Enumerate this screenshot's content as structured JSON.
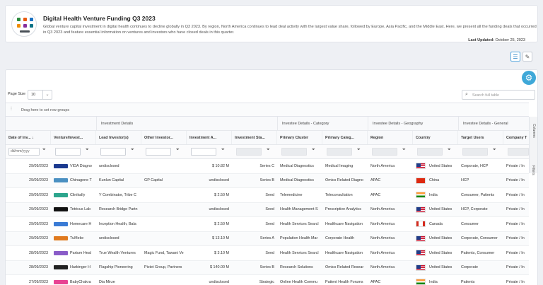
{
  "header": {
    "title": "Digital Health Venture Funding Q3 2023",
    "description": "Global venture capital investment in digital health continues to decline globally in Q3 2023. By region, North America continues to lead deal activity with the largest value share, followed by Europe, Asia Pacific, and the Middle East. Here, we present all the funding deals that occurred in Q3 2023 and feature essential information on ventures and investors who have closed deals in this quarter.",
    "updated_label": "Last Updated:",
    "updated_value": "October 25, 2023"
  },
  "toolbar": {
    "page_size_label": "Page Size",
    "page_size_value": "10",
    "search_placeholder": "Search full table",
    "group_hint": "Drag here to set row groups"
  },
  "side_tabs": {
    "columns": "Columns",
    "filters": "Filters"
  },
  "column_groups": [
    "Investment Details",
    "Investee Details - Category",
    "Investee Details - Geography",
    "Investee Details - General"
  ],
  "columns": [
    "Date of Inv...",
    "Venture/Invest...",
    "Lead Investor(s)",
    "Other Investor...",
    "Investment A...",
    "Investment Sta...",
    "Primary Cluster",
    "Primary Categ...",
    "Region",
    "Country",
    "Target Users",
    "Company T"
  ],
  "date_filter_placeholder": "dd/mm/yyyy",
  "rows": [
    {
      "date": "29/09/2023",
      "venture": "VIDA Diagno",
      "lead": "undisclosed",
      "other": "",
      "amount": "$ 10.82 M",
      "stage": "Series C",
      "cluster": "Medical Diagnostics",
      "category": "Medical Imaging",
      "region": "North America",
      "country": "United States",
      "flag": "us",
      "users": "Corporate, HCP",
      "company": "Private / In"
    },
    {
      "date": "29/09/2023",
      "venture": "Chinagene T",
      "lead": "Kunlun Capital",
      "other": "GP Capital",
      "amount": "undisclosed",
      "stage": "Series B",
      "cluster": "Medical Diagnostics",
      "category": "Omics Related Diagno",
      "region": "APAC",
      "country": "China",
      "flag": "cn",
      "users": "HCP",
      "company": "Private / In"
    },
    {
      "date": "29/09/2023",
      "venture": "Clinikally",
      "lead": "Y Combinator, Tribe C",
      "other": "",
      "amount": "$ 2.50 M",
      "stage": "Seed",
      "cluster": "Telemedicine",
      "category": "Teleconsultation",
      "region": "APAC",
      "country": "India",
      "flag": "in",
      "users": "Consumer, Patients",
      "company": "Private / In"
    },
    {
      "date": "29/09/2023",
      "venture": "Tetricus Lab",
      "lead": "Research Bridge Partn",
      "other": "",
      "amount": "undisclosed",
      "stage": "Seed",
      "cluster": "Health Management S",
      "category": "Prescriptive Analytics",
      "region": "North America",
      "country": "United States",
      "flag": "us",
      "users": "HCP, Corporate",
      "company": "Private / In"
    },
    {
      "date": "29/09/2023",
      "venture": "Homecare H",
      "lead": "Inception Health, Bala",
      "other": "",
      "amount": "$ 2.50 M",
      "stage": "Seed",
      "cluster": "Health Services Searcl",
      "category": "Healthcare Navigation",
      "region": "North America",
      "country": "Canada",
      "flag": "ca",
      "users": "Consumer",
      "company": "Private / In"
    },
    {
      "date": "29/09/2023",
      "venture": "TuMeke",
      "lead": "undisclosed",
      "other": "",
      "amount": "$ 13.10 M",
      "stage": "Series A",
      "cluster": "Population Health Mar",
      "category": "Corporate Health",
      "region": "North America",
      "country": "United States",
      "flag": "us",
      "users": "Corporate, Consumer",
      "company": "Private / In"
    },
    {
      "date": "28/09/2023",
      "venture": "Partum Heal",
      "lead": "True Wealth Ventures",
      "other": "Magic Fund, Tawani Ve",
      "amount": "$ 3.10 M",
      "stage": "Seed",
      "cluster": "Health Services Searcl",
      "category": "Healthcare Navigation",
      "region": "North America",
      "country": "United States",
      "flag": "us",
      "users": "Patients, Consumer",
      "company": "Private / In"
    },
    {
      "date": "28/09/2023",
      "venture": "Harbinger H",
      "lead": "Flagship Pioneering",
      "other": "Pictet Group, Partners",
      "amount": "$ 140.00 M",
      "stage": "Series B",
      "cluster": "Research Solutions",
      "category": "Omics Related Resear",
      "region": "North America",
      "country": "United States",
      "flag": "us",
      "users": "Corporate",
      "company": "Private / In"
    },
    {
      "date": "27/09/2023",
      "venture": "BabyChakra",
      "lead": "Dia Mirze",
      "other": "",
      "amount": "undisclosed",
      "stage": "Strategic",
      "cluster": "Online Health Commu",
      "category": "Patient Health Forums",
      "region": "APAC",
      "country": "India",
      "flag": "in",
      "users": "Patients",
      "company": "Private / In"
    }
  ]
}
